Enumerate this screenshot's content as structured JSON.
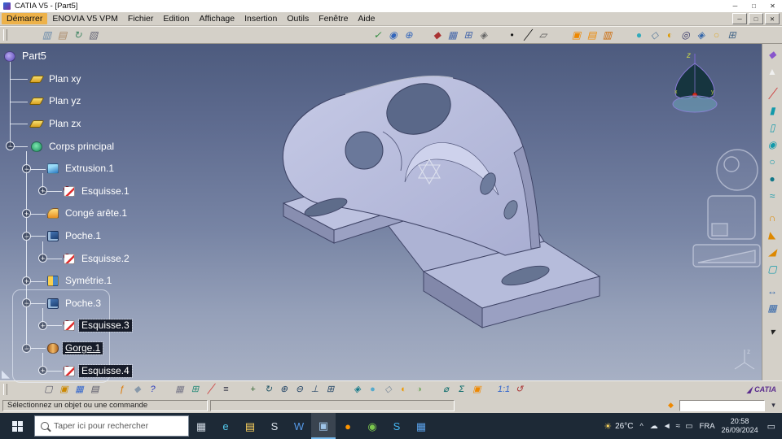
{
  "titlebar": {
    "title": "CATIA V5 - [Part5]",
    "minimize": "─",
    "maximize": "□",
    "close": "✕"
  },
  "menubar": {
    "items": [
      {
        "label": "Démarrer",
        "name": "menu-demarrer",
        "accent": true
      },
      {
        "label": "ENOVIA V5 VPM",
        "name": "menu-enovia-v5-vpm"
      },
      {
        "label": "Fichier",
        "name": "menu-fichier"
      },
      {
        "label": "Edition",
        "name": "menu-edition"
      },
      {
        "label": "Affichage",
        "name": "menu-affichage"
      },
      {
        "label": "Insertion",
        "name": "menu-insertion"
      },
      {
        "label": "Outils",
        "name": "menu-outils"
      },
      {
        "label": "Fenêtre",
        "name": "menu-fenetre"
      },
      {
        "label": "Aide",
        "name": "menu-aide"
      }
    ],
    "mdi": {
      "minimize": "─",
      "maximize": "□",
      "close": "✕"
    }
  },
  "top_toolbar": {
    "icons": [
      {
        "name": "data-save-icon",
        "glyph": "▥",
        "color": "#6688aa",
        "gap": 34
      },
      {
        "name": "data-open-icon",
        "glyph": "▤",
        "color": "#aa8866"
      },
      {
        "name": "vpm-sync-icon",
        "glyph": "↻",
        "color": "#448866"
      },
      {
        "name": "vpm-delete-icon",
        "glyph": "▧",
        "color": "#666677"
      },
      {
        "name": "spellcheck-icon",
        "glyph": "✓",
        "color": "#2a8a3a",
        "gap": 330
      },
      {
        "name": "search-doc-icon",
        "glyph": "◉",
        "color": "#3366bb"
      },
      {
        "name": "link-manager-icon",
        "glyph": "⊕",
        "color": "#3366bb"
      },
      {
        "name": "pin-item-icon",
        "glyph": "◆",
        "color": "#aa3333",
        "gap": 16
      },
      {
        "name": "grid-icon",
        "glyph": "▦",
        "color": "#4466aa"
      },
      {
        "name": "snap-to-grid-icon",
        "glyph": "⊞",
        "color": "#4466aa"
      },
      {
        "name": "magnet-snap-icon",
        "glyph": "◈",
        "color": "#666666"
      },
      {
        "name": "point-icon",
        "glyph": "•",
        "color": "#111111",
        "gap": 16
      },
      {
        "name": "line-icon",
        "glyph": "╱",
        "color": "#111111"
      },
      {
        "name": "plane-icon",
        "glyph": "▱",
        "color": "#555555"
      },
      {
        "name": "catalog-icon",
        "glyph": "▣",
        "color": "#ee8800",
        "gap": 22
      },
      {
        "name": "catalog-browser-icon",
        "glyph": "▤",
        "color": "#ee8800"
      },
      {
        "name": "material-library-icon",
        "glyph": "▥",
        "color": "#cc6600"
      },
      {
        "name": "shading-mode-icon",
        "glyph": "●",
        "color": "#33aabb",
        "gap": 20
      },
      {
        "name": "wireframe-mode-icon",
        "glyph": "◇",
        "color": "#557799"
      },
      {
        "name": "hide-show-icon",
        "glyph": "◐",
        "color": "#dd9900"
      },
      {
        "name": "texture-view-icon",
        "glyph": "◎",
        "color": "#333366"
      },
      {
        "name": "depth-effect-icon",
        "glyph": "◈",
        "color": "#3366aa"
      },
      {
        "name": "lighting-icon",
        "glyph": "○",
        "color": "#ddaa33"
      },
      {
        "name": "fullscreen-icon",
        "glyph": "⊞",
        "color": "#446688"
      }
    ]
  },
  "tree": {
    "items": [
      {
        "label": "Part5",
        "level": 0,
        "icon": "part",
        "name": "tree-item-part5"
      },
      {
        "label": "Plan xy",
        "level": 1,
        "icon": "plane",
        "name": "tree-item-plan-xy"
      },
      {
        "label": "Plan yz",
        "level": 1,
        "icon": "plane",
        "name": "tree-item-plan-yz"
      },
      {
        "label": "Plan zx",
        "level": 1,
        "icon": "plane",
        "name": "tree-item-plan-zx"
      },
      {
        "label": "Corps principal",
        "level": 1,
        "icon": "body",
        "handle": "minus",
        "name": "tree-item-corps-principal"
      },
      {
        "label": "Extrusion.1",
        "level": 2,
        "icon": "pad",
        "handle": "minus",
        "name": "tree-item-extrusion-1"
      },
      {
        "label": "Esquisse.1",
        "level": 3,
        "icon": "sketch",
        "handle": "plus",
        "name": "tree-item-esquisse-1"
      },
      {
        "label": "Congé arête.1",
        "level": 2,
        "icon": "fillet",
        "handle": "plus",
        "name": "tree-item-conge-arete-1"
      },
      {
        "label": "Poche.1",
        "level": 2,
        "icon": "pocket",
        "handle": "minus",
        "name": "tree-item-poche-1"
      },
      {
        "label": "Esquisse.2",
        "level": 3,
        "icon": "sketch",
        "handle": "plus",
        "name": "tree-item-esquisse-2"
      },
      {
        "label": "Symétrie.1",
        "level": 2,
        "icon": "symmetry",
        "handle": "plus",
        "name": "tree-item-symetrie-1"
      },
      {
        "label": "Poche.3",
        "level": 2,
        "icon": "pocket",
        "handle": "minus",
        "name": "tree-item-poche-3"
      },
      {
        "label": "Esquisse.3",
        "level": 3,
        "icon": "sketch",
        "handle": "plus",
        "selected": true,
        "name": "tree-item-esquisse-3"
      },
      {
        "label": "Gorge.1",
        "level": 2,
        "icon": "groove",
        "handle": "minus",
        "selected": true,
        "underline": true,
        "name": "tree-item-gorge-1"
      },
      {
        "label": "Esquisse.4",
        "level": 3,
        "icon": "sketch",
        "handle": "plus",
        "selected": true,
        "name": "tree-item-esquisse-4"
      }
    ]
  },
  "viewport": {
    "compass_z": "z",
    "compass_x": "x",
    "compass_y": "y",
    "axis_z": "z"
  },
  "right_toolbar": {
    "icons": [
      {
        "name": "workbench-icon",
        "glyph": "◆",
        "color": "#8855cc"
      },
      {
        "name": "select-arrow-icon",
        "glyph": "▲",
        "color": "#f0f0f0"
      },
      {
        "name": "sketcher-icon",
        "glyph": "╱",
        "color": "#cc3333",
        "gap": 6
      },
      {
        "name": "pad-icon",
        "glyph": "▮",
        "color": "#1199aa"
      },
      {
        "name": "pocket-icon",
        "glyph": "▯",
        "color": "#1199aa"
      },
      {
        "name": "shaft-icon",
        "glyph": "◉",
        "color": "#1199aa"
      },
      {
        "name": "groove-icon",
        "glyph": "○",
        "color": "#1199aa"
      },
      {
        "name": "hole-icon",
        "glyph": "●",
        "color": "#117788"
      },
      {
        "name": "rib-icon",
        "glyph": "≈",
        "color": "#1199aa"
      },
      {
        "name": "fillet-icon",
        "glyph": "∩",
        "color": "#dd8800",
        "gap": 6
      },
      {
        "name": "chamfer-icon",
        "glyph": "◣",
        "color": "#dd8800"
      },
      {
        "name": "draft-angle-icon",
        "glyph": "◢",
        "color": "#dd8800"
      },
      {
        "name": "shell-icon",
        "glyph": "▢",
        "color": "#1199aa"
      },
      {
        "name": "mirror-icon",
        "glyph": "↔",
        "color": "#3366aa",
        "gap": 6
      },
      {
        "name": "pattern-icon",
        "glyph": "▦",
        "color": "#3366aa"
      },
      {
        "name": "overflow-arrow-icon",
        "glyph": "▾",
        "color": "#222222",
        "gap": 8
      }
    ]
  },
  "bottom_toolbar": {
    "brand": "CATIA",
    "icons": [
      {
        "name": "new-document-icon",
        "glyph": "▢",
        "color": "#555566",
        "gap": 36
      },
      {
        "name": "open-icon",
        "glyph": "▣",
        "color": "#cc8800"
      },
      {
        "name": "save-icon",
        "glyph": "▦",
        "color": "#3366cc"
      },
      {
        "name": "print-icon",
        "glyph": "▤",
        "color": "#555566"
      },
      {
        "name": "knowledge-fx-icon",
        "glyph": "ƒ",
        "color": "#dd7700",
        "gap": 14
      },
      {
        "name": "annotation-icon",
        "glyph": "◆",
        "color": "#8899aa"
      },
      {
        "name": "help-icon",
        "glyph": "?",
        "color": "#2233bb"
      },
      {
        "name": "grid-toggle-icon",
        "glyph": "▦",
        "color": "#777788",
        "gap": 14
      },
      {
        "name": "attach-icon",
        "glyph": "⊞",
        "color": "#228877"
      },
      {
        "name": "pencil-icon",
        "glyph": "╱",
        "color": "#cc3333"
      },
      {
        "name": "list-icon",
        "glyph": "≡",
        "color": "#333344"
      },
      {
        "name": "pan-icon",
        "glyph": "+",
        "color": "#336633",
        "gap": 14
      },
      {
        "name": "rotate-icon",
        "glyph": "↻",
        "color": "#225566"
      },
      {
        "name": "zoom-in-icon",
        "glyph": "⊕",
        "color": "#224466"
      },
      {
        "name": "zoom-out-icon",
        "glyph": "⊖",
        "color": "#224466"
      },
      {
        "name": "normal-view-icon",
        "glyph": "⊥",
        "color": "#224466"
      },
      {
        "name": "multi-view-icon",
        "glyph": "⊞",
        "color": "#224466"
      },
      {
        "name": "iso-view-icon",
        "glyph": "◈",
        "color": "#117788",
        "gap": 14
      },
      {
        "name": "shaded-view-icon",
        "glyph": "●",
        "color": "#55aacc"
      },
      {
        "name": "wireframe-view-icon",
        "glyph": "◇",
        "color": "#778899"
      },
      {
        "name": "hide-show-swap-icon",
        "glyph": "◐",
        "color": "#ee9900"
      },
      {
        "name": "visible-space-icon",
        "glyph": "◑",
        "color": "#77aa66"
      },
      {
        "name": "measure-icon",
        "glyph": "⌀",
        "color": "#006666",
        "gap": 14
      },
      {
        "name": "mass-properties-icon",
        "glyph": "Σ",
        "color": "#006666"
      },
      {
        "name": "catalog-bottom-icon",
        "glyph": "▣",
        "color": "#ee8800"
      },
      {
        "name": "scale-icon",
        "glyph": "1:1",
        "color": "#3366cc",
        "gap": 14
      },
      {
        "name": "update-icon",
        "glyph": "↺",
        "color": "#aa3333"
      }
    ]
  },
  "statusbar": {
    "message": "Sélectionnez un objet ou une commande",
    "power_value": ""
  },
  "taskbar": {
    "search_placeholder": "Taper ici pour rechercher",
    "apps": [
      {
        "name": "task-view-button",
        "glyph": "▦",
        "color": "#cfd8e2"
      },
      {
        "name": "edge-icon",
        "glyph": "e",
        "color": "#55ccf0"
      },
      {
        "name": "file-explorer-icon",
        "glyph": "▤",
        "color": "#ffd45e"
      },
      {
        "name": "snip-tool-icon",
        "glyph": "S",
        "color": "#d8e0e8"
      },
      {
        "name": "word-icon",
        "glyph": "W",
        "color": "#5599e8"
      },
      {
        "name": "catia-taskbar-icon",
        "glyph": "▣",
        "color": "#9fc4e8",
        "active": true
      },
      {
        "name": "firefox-icon",
        "glyph": "●",
        "color": "#ff9500"
      },
      {
        "name": "chrome-icon",
        "glyph": "◉",
        "color": "#7bc74d"
      },
      {
        "name": "skype-icon",
        "glyph": "S",
        "color": "#45b6f2"
      },
      {
        "name": "office-icon",
        "glyph": "▦",
        "color": "#5aa0e8"
      }
    ],
    "tray": {
      "temp": "26°C",
      "caret": "^",
      "lang": "FRA",
      "time": "20:58",
      "date": "26/09/2024",
      "icons": [
        {
          "name": "onedrive-icon",
          "glyph": "☁"
        },
        {
          "name": "volume-icon",
          "glyph": "◄"
        },
        {
          "name": "network-icon",
          "glyph": "≈"
        },
        {
          "name": "battery-icon",
          "glyph": "▭"
        }
      ]
    }
  }
}
